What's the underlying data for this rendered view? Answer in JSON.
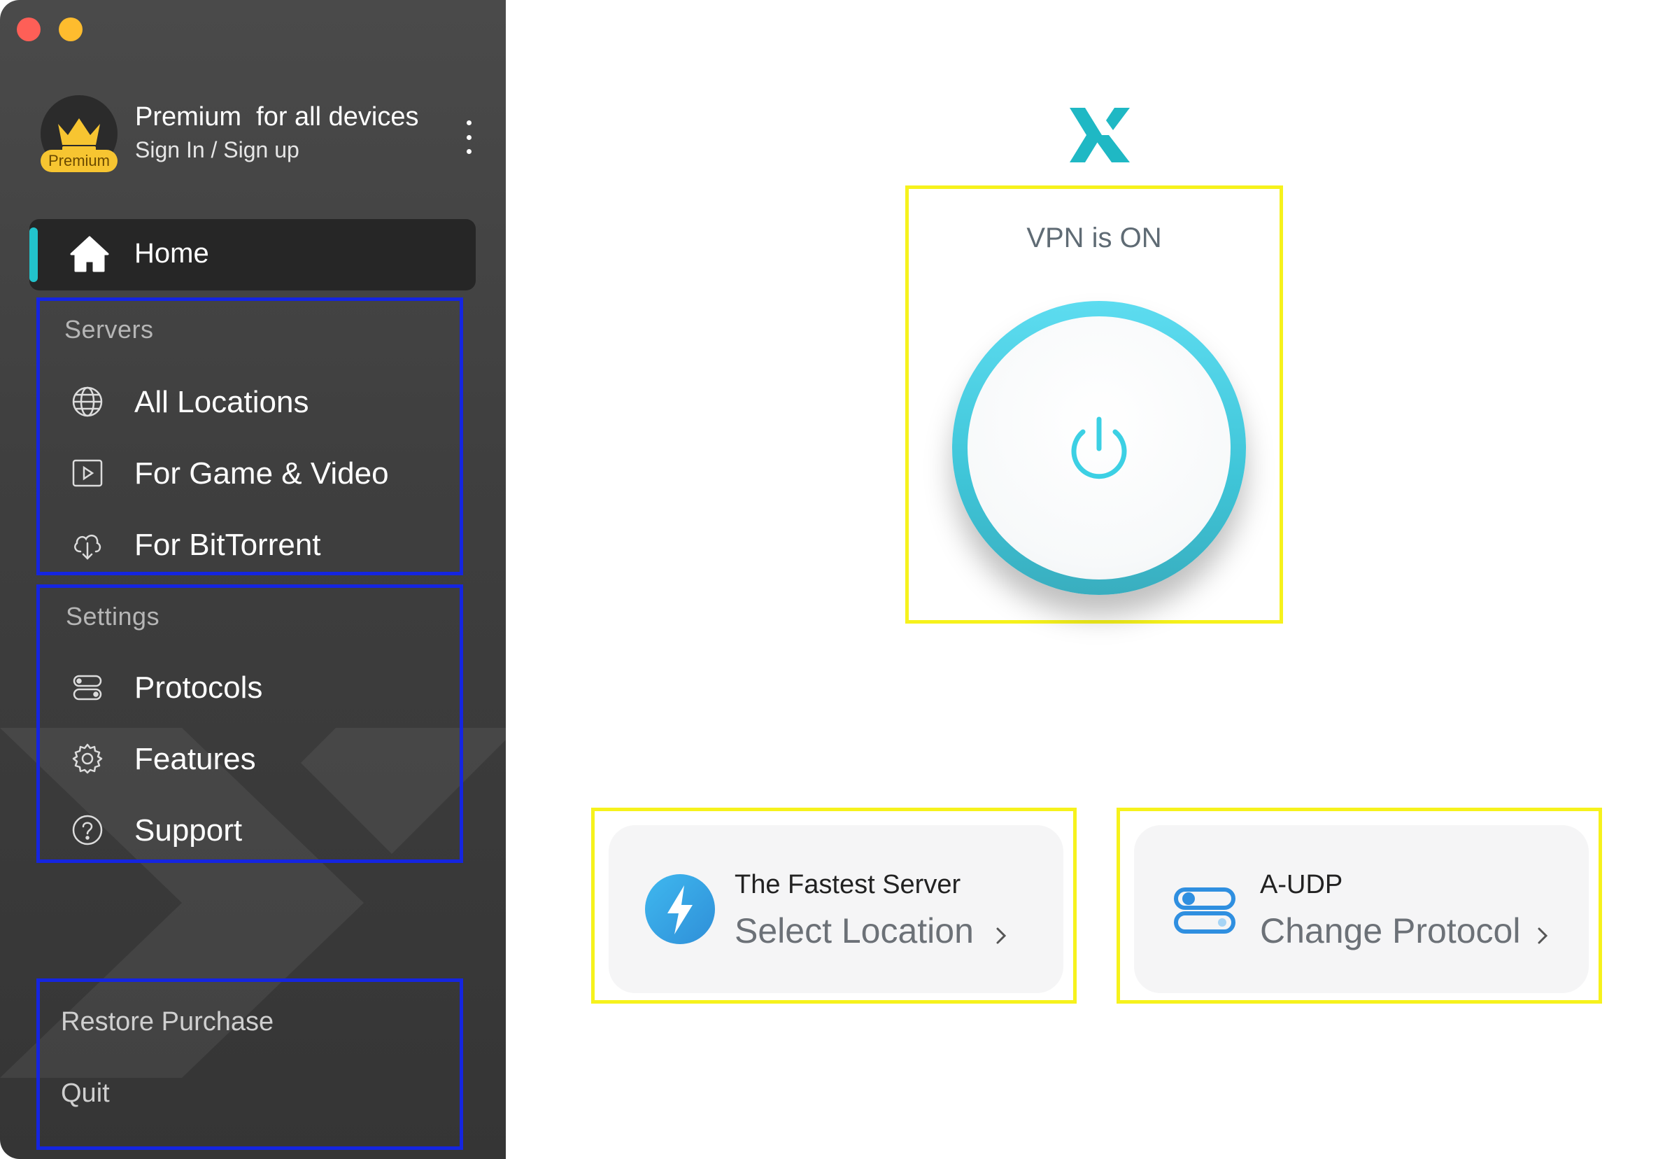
{
  "window": {
    "controls": [
      "close",
      "minimize"
    ]
  },
  "profile": {
    "title": "Premium  for all devices",
    "subtitle": "Sign In / Sign up",
    "badge": "Premium"
  },
  "sidebar": {
    "home": {
      "label": "Home",
      "icon": "home-icon",
      "selected": true
    },
    "servers": {
      "title": "Servers",
      "items": [
        {
          "label": "All Locations",
          "icon": "globe-icon"
        },
        {
          "label": "For Game & Video",
          "icon": "play-icon"
        },
        {
          "label": "For BitTorrent",
          "icon": "cloud-download-icon"
        }
      ]
    },
    "settings": {
      "title": "Settings",
      "items": [
        {
          "label": "Protocols",
          "icon": "toggles-icon"
        },
        {
          "label": "Features",
          "icon": "gear-icon"
        },
        {
          "label": "Support",
          "icon": "help-icon"
        }
      ]
    },
    "footer": {
      "restore": "Restore Purchase",
      "quit": "Quit"
    }
  },
  "main": {
    "vpn_status": "VPN is ON",
    "server_card": {
      "title": "The Fastest Server",
      "action": "Select Location"
    },
    "protocol_card": {
      "title": "A-UDP",
      "action": "Change Protocol"
    }
  },
  "colors": {
    "accent": "#22c3cc",
    "sidebar_bg": "#404040",
    "highlight_yellow": "#f6f21c",
    "highlight_blue": "#1525e0",
    "premium_gold": "#f7c531"
  }
}
